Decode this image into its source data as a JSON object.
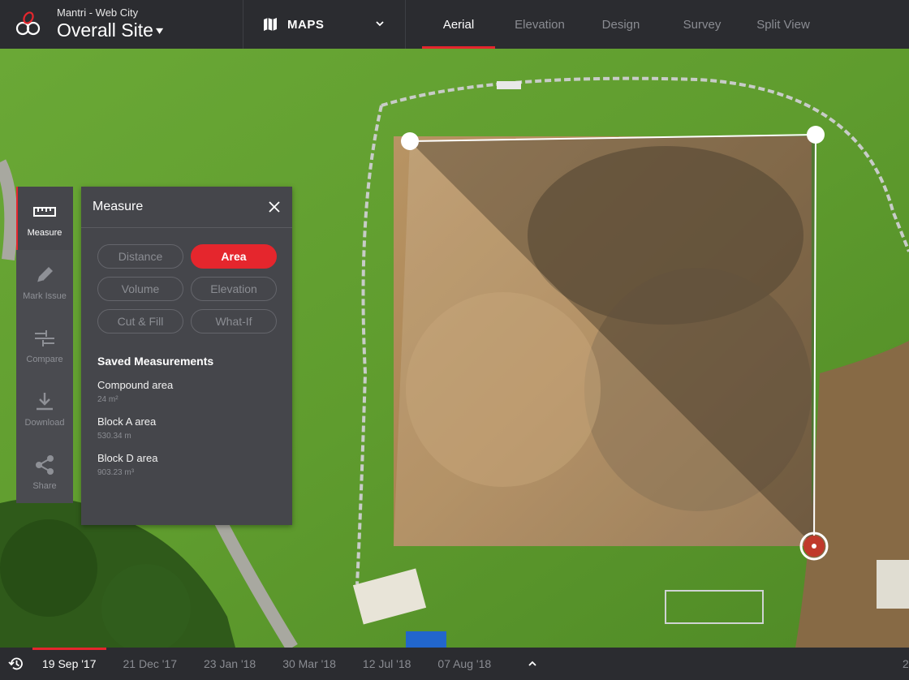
{
  "header": {
    "project": "Mantri - Web City",
    "site": "Overall Site",
    "site_chevron": "⌄",
    "map_selector": "MAPS",
    "tabs": [
      {
        "label": "Aerial",
        "active": true
      },
      {
        "label": "Elevation",
        "active": false
      },
      {
        "label": "Design",
        "active": false
      },
      {
        "label": "Survey",
        "active": false
      },
      {
        "label": "Split View",
        "active": false
      }
    ]
  },
  "rail": {
    "items": [
      {
        "label": "Measure",
        "icon": "ruler-icon",
        "active": true
      },
      {
        "label": "Mark Issue",
        "icon": "pencil-icon",
        "active": false
      },
      {
        "label": "Compare",
        "icon": "compare-icon",
        "active": false
      },
      {
        "label": "Download",
        "icon": "download-icon",
        "active": false
      },
      {
        "label": "Share",
        "icon": "share-icon",
        "active": false
      }
    ]
  },
  "panel": {
    "title": "Measure",
    "tools": [
      {
        "label": "Distance",
        "active": false
      },
      {
        "label": "Area",
        "active": true
      },
      {
        "label": "Volume",
        "active": false
      },
      {
        "label": "Elevation",
        "active": false
      },
      {
        "label": "Cut & Fill",
        "active": false
      },
      {
        "label": "What-If",
        "active": false
      }
    ],
    "saved_title": "Saved Measurements",
    "saved": [
      {
        "name": "Compound area",
        "value": "24 m²"
      },
      {
        "name": "Block A area",
        "value": "530.34 m"
      },
      {
        "name": "Block D area",
        "value": "903.23 m³"
      }
    ]
  },
  "timeline": {
    "dates": [
      {
        "label": "19 Sep '17",
        "active": true
      },
      {
        "label": "21 Dec '17",
        "active": false
      },
      {
        "label": "23 Jan '18",
        "active": false
      },
      {
        "label": "30 Mar '18",
        "active": false
      },
      {
        "label": "12 Jul '18",
        "active": false
      },
      {
        "label": "07 Aug '18",
        "active": false
      }
    ],
    "overflow_label": "2"
  },
  "colors": {
    "accent": "#e5262d",
    "topbar": "#2b2c30",
    "panel": "#45464b",
    "rail": "#4a4b50"
  }
}
